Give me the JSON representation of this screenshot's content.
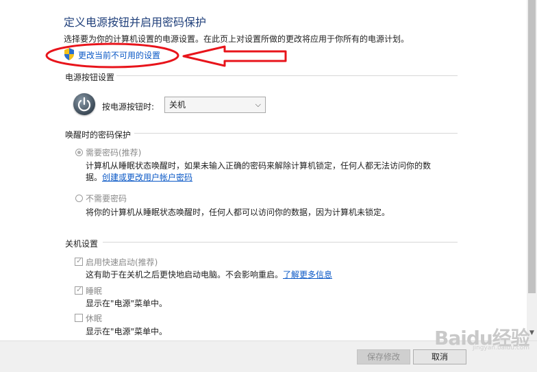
{
  "header": {
    "title": "定义电源按钮并启用密码保护",
    "subtitle": "选择要为你的计算机设置的电源设置。在此页上对设置所做的更改将应用于你所有的电源计划。",
    "change_link": "更改当前不可用的设置"
  },
  "power_button": {
    "section_title": "电源按钮设置",
    "label": "按电源按钮时:",
    "selected": "关机"
  },
  "password_protection": {
    "section_title": "唤醒时的密码保护",
    "require": {
      "label": "需要密码(推荐)",
      "desc_line1": "计算机从睡眠状态唤醒时，如果未输入正确的密码来解除计算机锁定，任何人都无法访问你的数",
      "desc_line2_prefix": "据。",
      "desc_link": "创建或更改用户帐户密码"
    },
    "not_require": {
      "label": "不需要密码",
      "desc": "将你的计算机从睡眠状态唤醒时，任何人都可以访问你的数据，因为计算机未锁定。"
    }
  },
  "shutdown": {
    "section_title": "关机设置",
    "fast_startup": {
      "label": "启用快速启动(推荐)",
      "desc_prefix": "这有助于在关机之后更快地启动电脑。不会影响重启。",
      "desc_link": "了解更多信息"
    },
    "sleep": {
      "label": "睡眠",
      "desc": "显示在\"电源\"菜单中。"
    },
    "hibernate": {
      "label": "休眠",
      "desc": "显示在\"电源\"菜单中。"
    }
  },
  "footer": {
    "save": "保存修改",
    "cancel": "取消"
  },
  "watermark": {
    "text": "Baidu经验",
    "sub": "jingyan.baidu.com"
  },
  "colors": {
    "annotation": "#e8141b",
    "link": "#0a58c6",
    "title": "#1f3f7a"
  }
}
